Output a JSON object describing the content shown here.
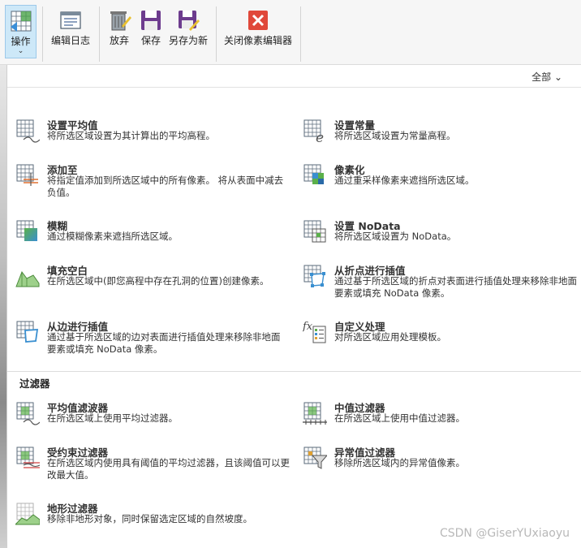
{
  "ribbon": {
    "operations": "操作",
    "edit_log": "编辑日志",
    "discard": "放弃",
    "save": "保存",
    "save_as": "另存为新",
    "close_editor": "关闭像素编辑器"
  },
  "filter": {
    "label": "全部"
  },
  "items": [
    {
      "title": "设置平均值",
      "desc": "将所选区域设置为其计算出的平均高程。",
      "icon": "grid-mean-icon"
    },
    {
      "title": "设置常量",
      "desc": "将所选区域设置为常量高程。",
      "icon": "grid-constant-icon"
    },
    {
      "title": "添加至",
      "desc": "将指定值添加到所选区域中的所有像素。 将从表面中减去负值。",
      "icon": "grid-add-icon"
    },
    {
      "title": "像素化",
      "desc": "通过重采样像素来遮挡所选区域。",
      "icon": "grid-pixelate-icon"
    },
    {
      "title": "模糊",
      "desc": "通过模糊像素来遮挡所选区域。",
      "icon": "grid-blur-icon"
    },
    {
      "title": "设置 NoData",
      "desc": "将所选区域设置为 NoData。",
      "icon": "grid-nodata-icon"
    },
    {
      "title": "填充空白",
      "desc": "在所选区域中(即您高程中存在孔洞的位置)创建像素。",
      "icon": "fill-gaps-icon"
    },
    {
      "title": "从折点进行插值",
      "desc": "通过基于所选区域的折点对表面进行插值处理来移除非地面要素或填充 NoData 像素。",
      "icon": "interpolate-vertices-icon"
    },
    {
      "title": "从边进行插值",
      "desc": "通过基于所选区域的边对表面进行插值处理来移除非地面要素或填充 NoData 像素。",
      "icon": "interpolate-edges-icon"
    },
    {
      "title": "自定义处理",
      "desc": "对所选区域应用处理模板。",
      "icon": "custom-process-icon"
    }
  ],
  "filters_section": {
    "title": "过滤器",
    "items": [
      {
        "title": "平均值滤波器",
        "desc": "在所选区域上使用平均过滤器。",
        "icon": "mean-filter-icon"
      },
      {
        "title": "中值过滤器",
        "desc": "在所选区域上使用中值过滤器。",
        "icon": "median-filter-icon"
      },
      {
        "title": "受约束过滤器",
        "desc": "在所选区域内使用具有阈值的平均过滤器，且该阈值可以更改最大值。",
        "icon": "constrained-filter-icon"
      },
      {
        "title": "异常值过滤器",
        "desc": "移除所选区域内的异常值像素。",
        "icon": "outlier-filter-icon"
      },
      {
        "title": "地形过滤器",
        "desc": "移除非地形对象，同时保留选定区域的自然坡度。",
        "icon": "terrain-filter-icon"
      }
    ]
  },
  "watermark": "CSDN @GiserYUxiaoyu"
}
